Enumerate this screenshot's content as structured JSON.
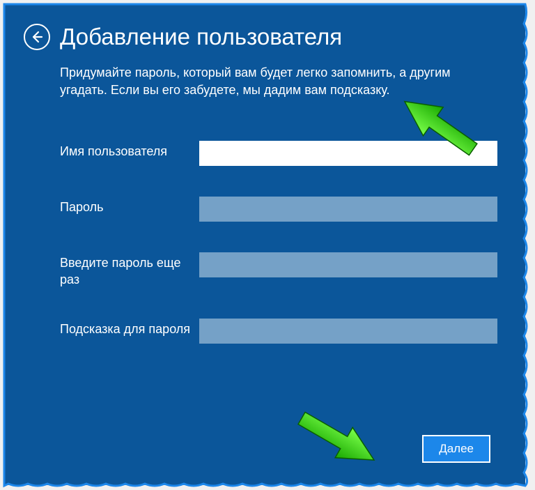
{
  "header": {
    "title": "Добавление пользователя"
  },
  "description": "Придумайте пароль, который вам будет легко запомнить, а другим угадать. Если вы его забудете, мы дадим вам подсказку.",
  "fields": {
    "username": {
      "label": "Имя пользователя",
      "value": ""
    },
    "password": {
      "label": "Пароль",
      "value": ""
    },
    "password_confirm": {
      "label": "Введите пароль еще раз",
      "value": ""
    },
    "hint": {
      "label": "Подсказка для пароля",
      "value": ""
    }
  },
  "buttons": {
    "next": "Далее"
  }
}
